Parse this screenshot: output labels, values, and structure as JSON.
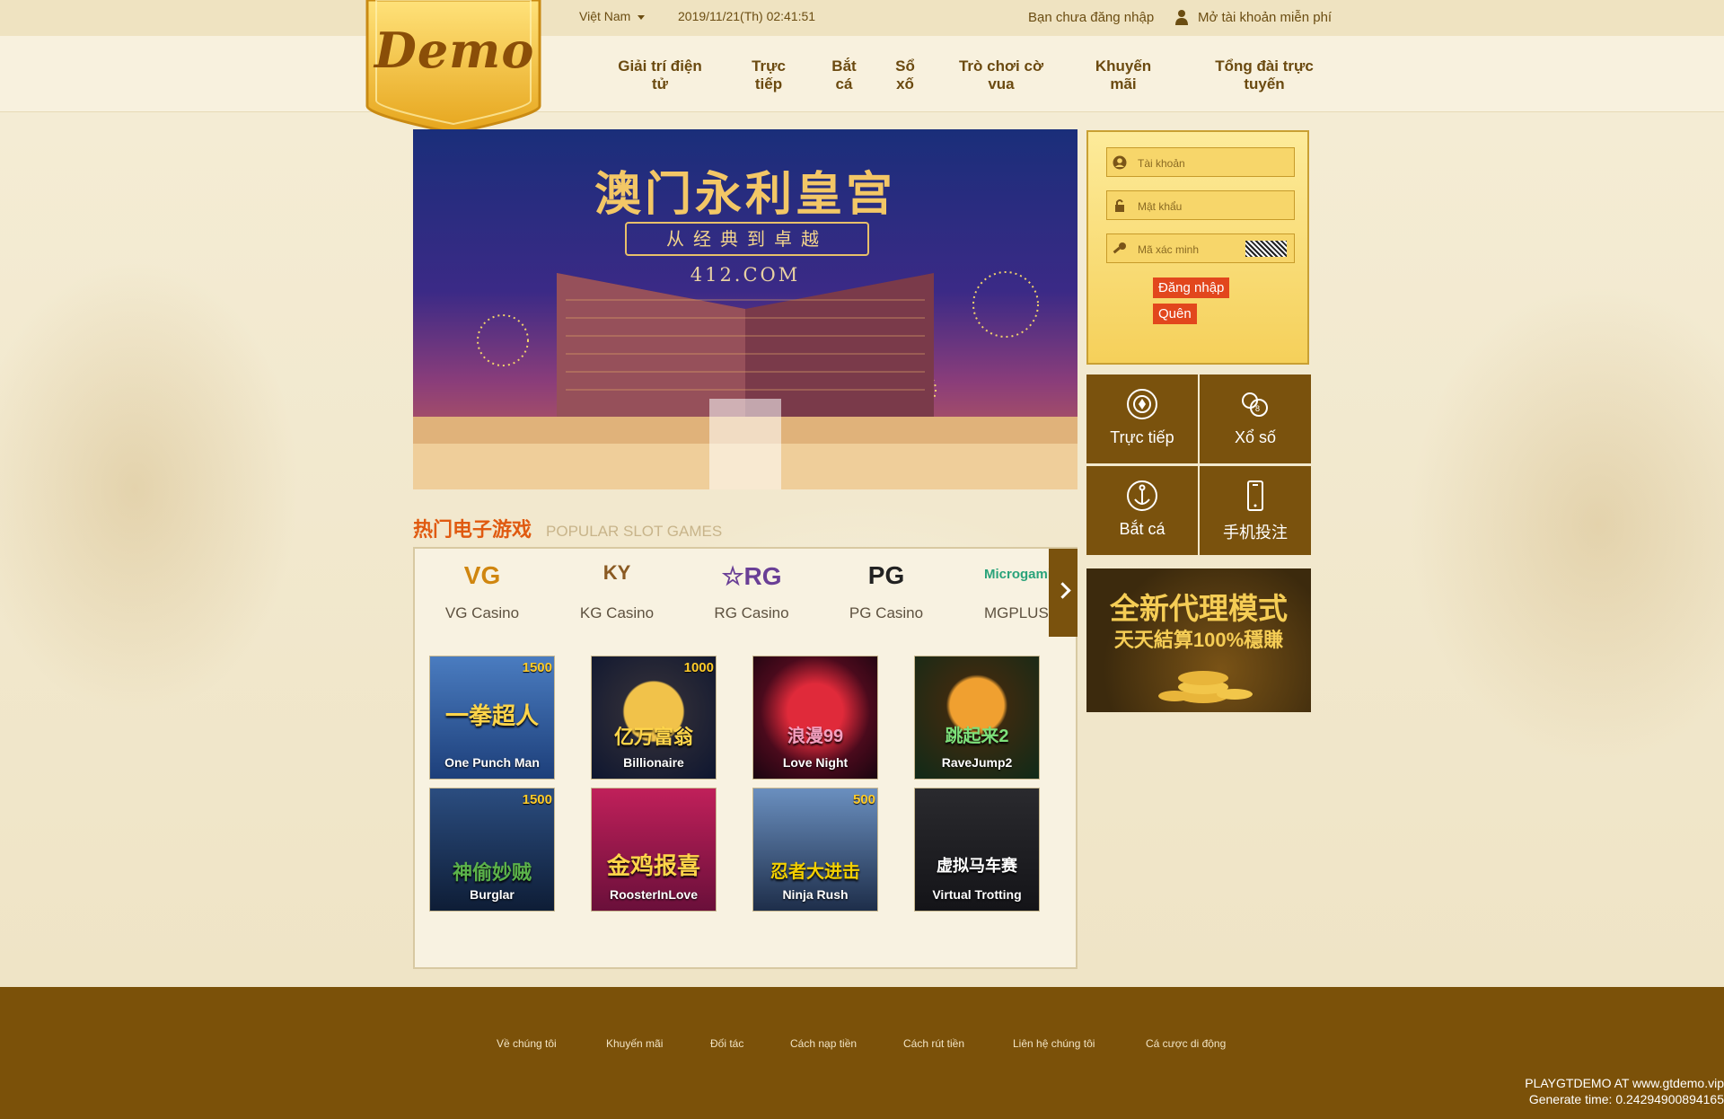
{
  "header": {
    "language": "Việt Nam",
    "datetime": "2019/11/21(Th) 02:41:51",
    "not_logged_in": "Bạn chưa đăng nhập",
    "register": "Mở tài khoản miễn phí",
    "logo_text": "Demo"
  },
  "nav": [
    {
      "line1": "Giải trí điện",
      "line2": "tử"
    },
    {
      "line1": "Trực",
      "line2": "tiếp"
    },
    {
      "line1": "Bắt",
      "line2": "cá"
    },
    {
      "line1": "Sổ",
      "line2": "xố"
    },
    {
      "line1": "Trò chơi cờ",
      "line2": "vua"
    },
    {
      "line1": "Khuyến",
      "line2": "mãi"
    },
    {
      "line1": "Tổng đài trực",
      "line2": "tuyến"
    }
  ],
  "banner": {
    "title": "澳门永利皇宫",
    "subtitle": "从经典到卓越",
    "domain": "412.COM"
  },
  "login": {
    "username_placeholder": "Tài khoản",
    "password_placeholder": "Mật khẩu",
    "captcha_placeholder": "Mã xác minh",
    "login_button": "Đăng nhập",
    "forgot_button": "Quên"
  },
  "tiles": [
    {
      "label": "Trực tiếp",
      "icon": "poker-chip-icon"
    },
    {
      "label": "Xổ số",
      "icon": "lottery-balls-icon"
    },
    {
      "label": "Bắt cá",
      "icon": "anchor-icon"
    },
    {
      "label": "手机投注",
      "icon": "mobile-phone-icon"
    }
  ],
  "promo": {
    "line1": "全新代理模式",
    "line2": "天天結算100%穩賺"
  },
  "slots": {
    "heading_cn": "热门电子游戏",
    "heading_en": "POPULAR SLOT GAMES",
    "providers": [
      {
        "name": "VG Casino",
        "logo": "VG",
        "color": "#d0860f"
      },
      {
        "name": "KG Casino",
        "logo": "KY",
        "color": "#8a5a22"
      },
      {
        "name": "RG Casino",
        "logo": "☆RG",
        "color": "#6a3f96"
      },
      {
        "name": "PG Casino",
        "logo": "PG",
        "color": "#222222"
      },
      {
        "name": "MGPLUS Casino",
        "logo": "Microgaming",
        "color": "#2aa37a"
      }
    ],
    "games": [
      {
        "name": "One Punch Man",
        "badge": "1500",
        "cn": "一拳超人"
      },
      {
        "name": "Billionaire",
        "badge": "1000",
        "cn": "亿万富翁"
      },
      {
        "name": "Love Night",
        "badge": "",
        "cn": "浪漫99"
      },
      {
        "name": "RaveJump2",
        "badge": "",
        "cn": "跳起来2"
      },
      {
        "name": "Burglar",
        "badge": "1500",
        "cn": "神偷妙贼"
      },
      {
        "name": "RoosterInLove",
        "badge": "",
        "cn": "金鸡报喜"
      },
      {
        "name": "Ninja Rush",
        "badge": "500",
        "cn": "忍者大进击"
      },
      {
        "name": "Virtual Trotting",
        "badge": "",
        "cn": "虚拟马车赛"
      }
    ]
  },
  "footer": {
    "links": [
      "Về chúng tôi",
      "Khuyến mãi",
      "Đối tác",
      "Cách nạp tiền",
      "Cách rút tiền",
      "Liên hệ chúng tôi",
      "Cá cược di động"
    ],
    "credit_line1": "PLAYGTDEMO AT www.gtdemo.vip",
    "credit_line2": "Generate time: 0.24294900894165"
  }
}
